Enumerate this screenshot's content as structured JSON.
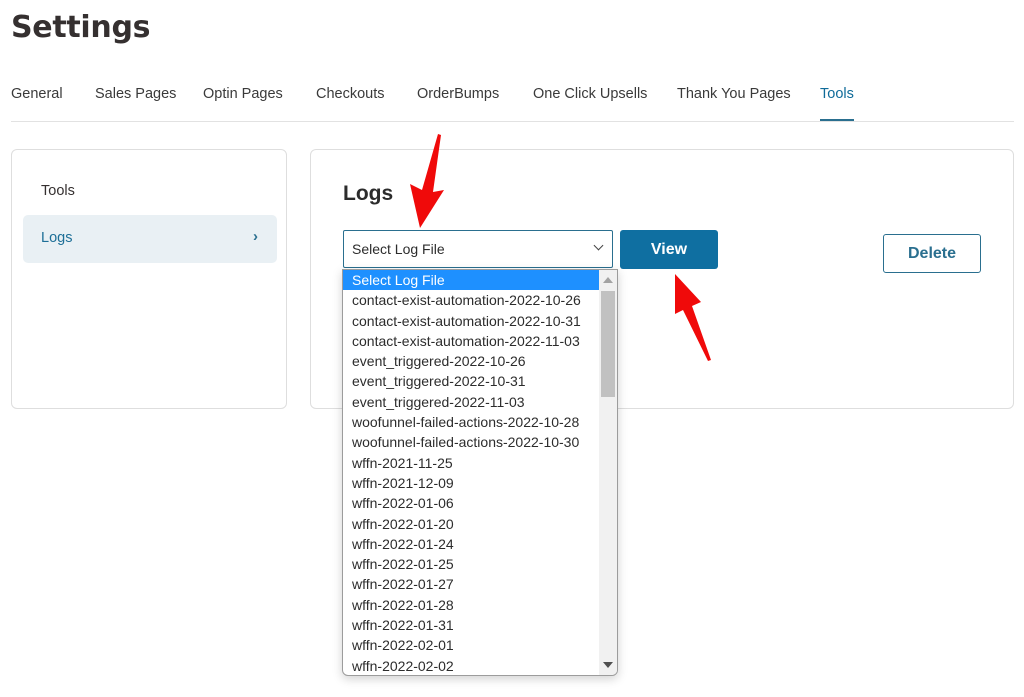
{
  "page": {
    "title": "Settings"
  },
  "tabs": [
    {
      "label": "General",
      "active": false
    },
    {
      "label": "Sales Pages",
      "active": false
    },
    {
      "label": "Optin Pages",
      "active": false
    },
    {
      "label": "Checkouts",
      "active": false
    },
    {
      "label": "OrderBumps",
      "active": false
    },
    {
      "label": "One Click Upsells",
      "active": false
    },
    {
      "label": "Thank You Pages",
      "active": false
    },
    {
      "label": "Tools",
      "active": true
    }
  ],
  "sidebar": {
    "heading": "Tools",
    "items": [
      {
        "label": "Logs",
        "active": true,
        "icon": "chevron-right-icon"
      }
    ]
  },
  "logs": {
    "title": "Logs",
    "select": {
      "value": "Select Log File",
      "options": [
        "Select Log File",
        "contact-exist-automation-2022-10-26",
        "contact-exist-automation-2022-10-31",
        "contact-exist-automation-2022-11-03",
        "event_triggered-2022-10-26",
        "event_triggered-2022-10-31",
        "event_triggered-2022-11-03",
        "woofunnel-failed-actions-2022-10-28",
        "woofunnel-failed-actions-2022-10-30",
        "wffn-2021-11-25",
        "wffn-2021-12-09",
        "wffn-2022-01-06",
        "wffn-2022-01-20",
        "wffn-2022-01-24",
        "wffn-2022-01-25",
        "wffn-2022-01-27",
        "wffn-2022-01-28",
        "wffn-2022-01-31",
        "wffn-2022-02-01",
        "wffn-2022-02-02"
      ],
      "highlighted_index": 0
    },
    "view_label": "View",
    "delete_label": "Delete"
  },
  "colors": {
    "accent": "#0f6fa1",
    "active_tab": "#0f6b99",
    "sidebar_active_bg": "#e9f0f4",
    "option_highlight": "#1e90ff",
    "annotation_arrow": "#ff0000"
  }
}
